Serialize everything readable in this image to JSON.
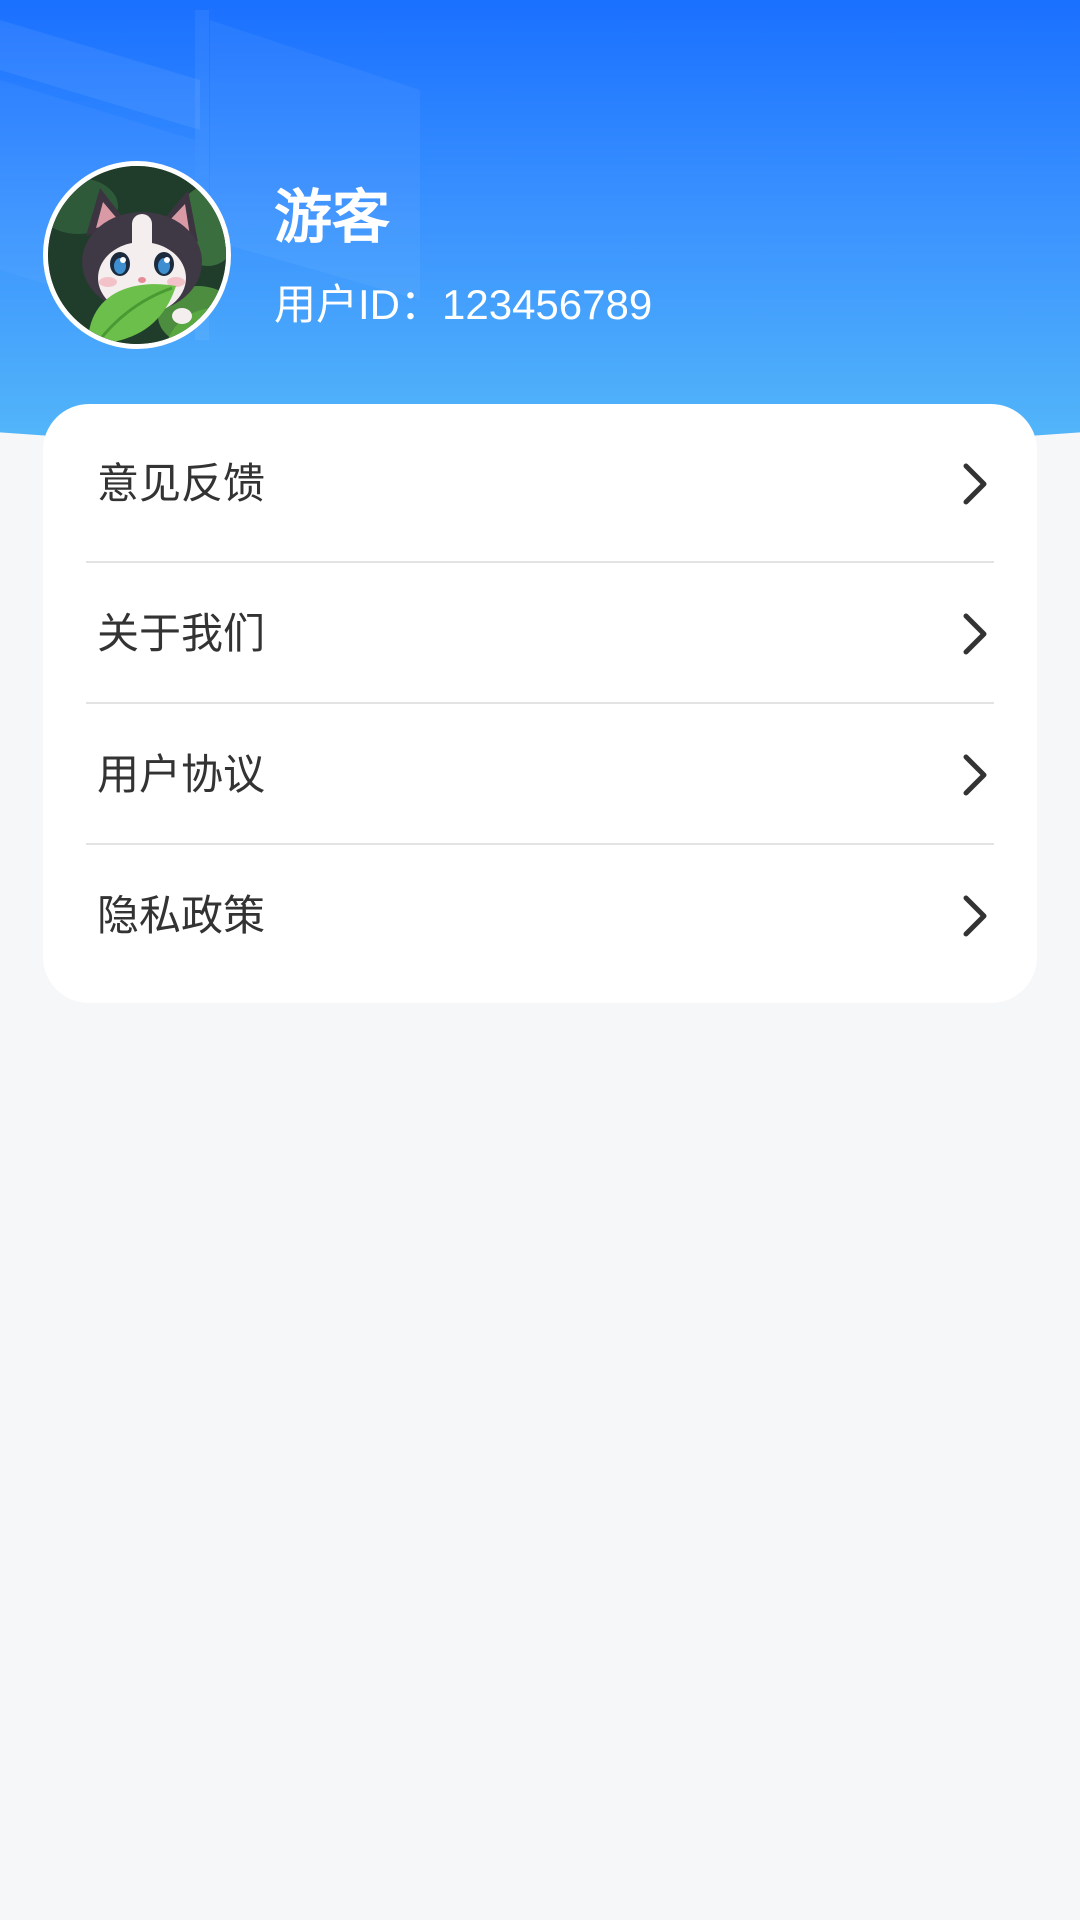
{
  "profile": {
    "name": "游客",
    "user_id": "用户ID：123456789",
    "avatar_icon": "cat-avatar-image"
  },
  "menu": {
    "items": [
      {
        "label": "意见反馈",
        "icon": "chevron-right-icon"
      },
      {
        "label": "关于我们",
        "icon": "chevron-right-icon"
      },
      {
        "label": "用户协议",
        "icon": "chevron-right-icon"
      },
      {
        "label": "隐私政策",
        "icon": "chevron-right-icon"
      }
    ]
  },
  "colors": {
    "header_top": "#1a70ff",
    "header_bottom": "#56baf8",
    "page_background": "#f6f7f9",
    "card_background": "#ffffff",
    "text_primary": "#333333",
    "divider": "#e3e3e3"
  }
}
